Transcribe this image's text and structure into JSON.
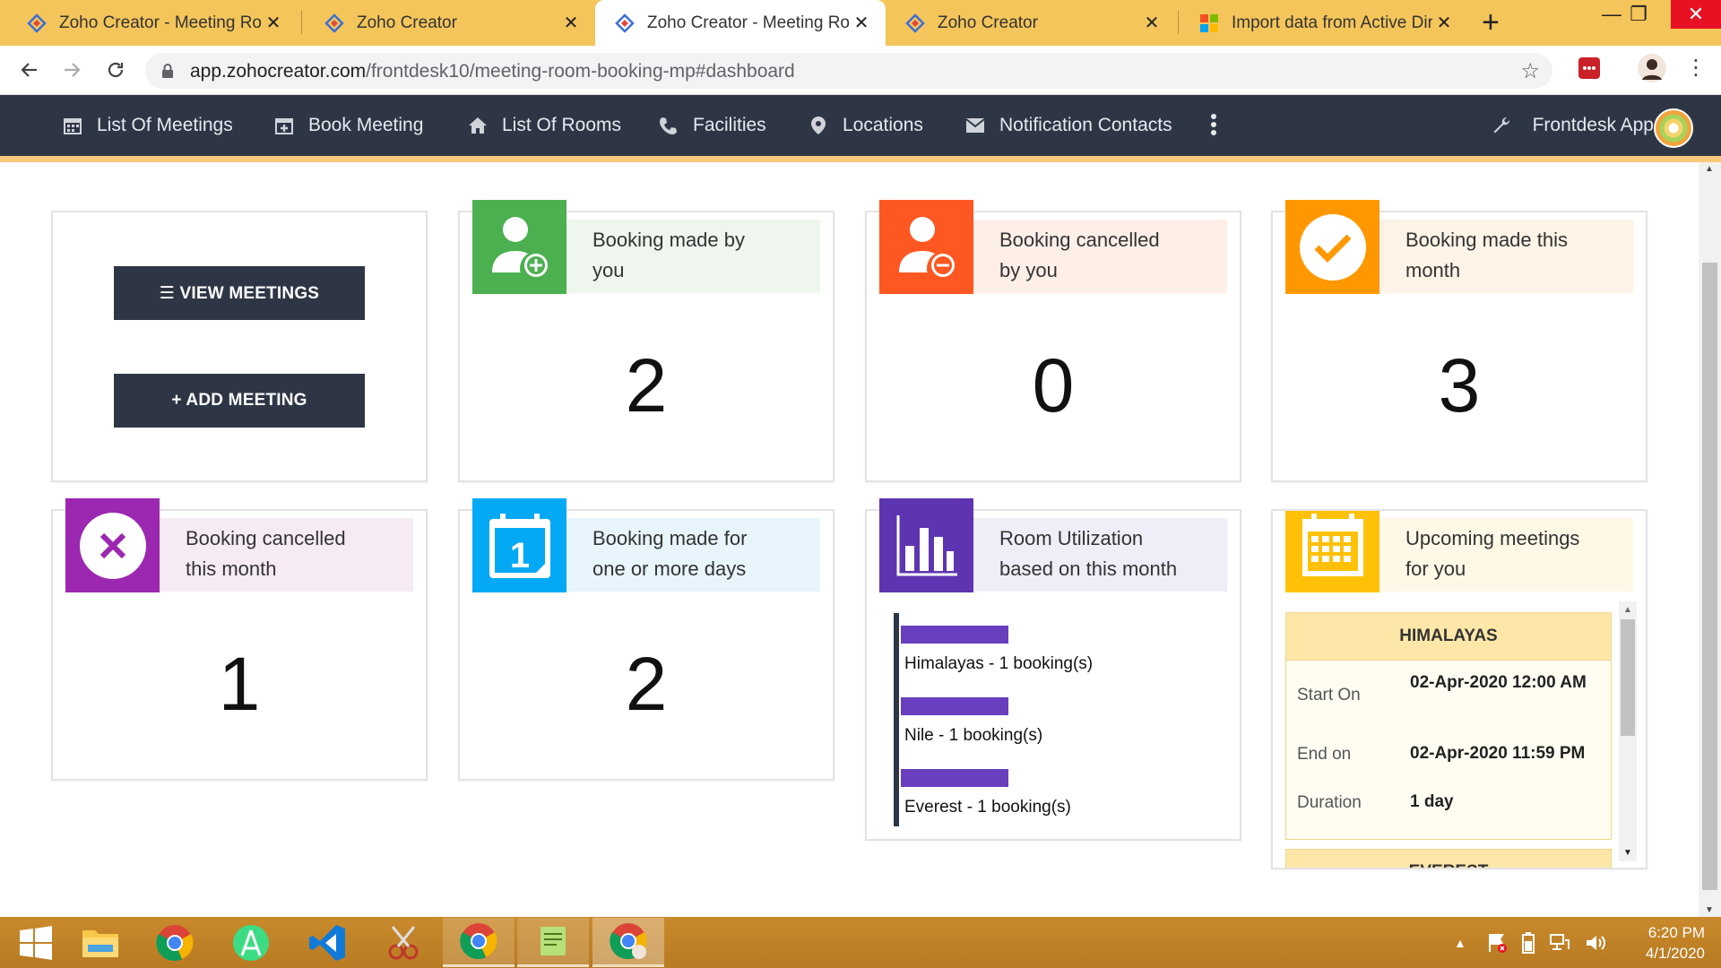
{
  "browser": {
    "tabs": [
      {
        "title": "Zoho Creator - Meeting Roo",
        "close": "✕"
      },
      {
        "title": "Zoho Creator",
        "close": "✕"
      },
      {
        "title": "Zoho Creator - Meeting Roo",
        "close": "✕"
      },
      {
        "title": "Zoho Creator",
        "close": "✕"
      },
      {
        "title": "Import data from Active Dire",
        "close": "✕"
      }
    ],
    "new_tab": "+",
    "window_controls": {
      "minimize": "—",
      "maximize": "❐",
      "close": "✕"
    },
    "url_host": "app.zohocreator.com",
    "url_path": "/frontdesk10/meeting-room-booking-mp#dashboard"
  },
  "nav": {
    "items": [
      {
        "label": "List Of Meetings",
        "icon": "calendar-icon"
      },
      {
        "label": "Book Meeting",
        "icon": "calendar-plus-icon"
      },
      {
        "label": "List Of Rooms",
        "icon": "home-icon"
      },
      {
        "label": "Facilities",
        "icon": "phone-icon"
      },
      {
        "label": "Locations",
        "icon": "map-pin-icon"
      },
      {
        "label": "Notification Contacts",
        "icon": "envelope-icon"
      }
    ],
    "app_name": "Frontdesk App"
  },
  "actions": {
    "view_meetings": "☰ VIEW MEETINGS",
    "add_meeting": "+ ADD MEETING"
  },
  "cards": [
    {
      "label_line1": "Booking made by",
      "label_line2": "you",
      "value": "2",
      "color": "#4caf50",
      "tint": "#eef6ee"
    },
    {
      "label_line1": "Booking cancelled",
      "label_line2": "by you",
      "value": "0",
      "color": "#ff5722",
      "tint": "#fdeee8"
    },
    {
      "label_line1": "Booking made this",
      "label_line2": "month",
      "value": "3",
      "color": "#ff9800",
      "tint": "#fdf3e6"
    },
    {
      "label_line1": "Booking cancelled",
      "label_line2": "this month",
      "value": "1",
      "color": "#9c27b0",
      "tint": "#f6ebf5"
    },
    {
      "label_line1": "Booking made for",
      "label_line2": "one or more days",
      "value": "2",
      "color": "#03a9f4",
      "tint": "#e8f5fc"
    },
    {
      "label_line1": "Room Utilization",
      "label_line2": "based on this month",
      "color": "#5e35b1",
      "tint": "#efedf7"
    },
    {
      "label_line1": "Upcoming meetings",
      "label_line2": "for you",
      "color": "#ffc107",
      "tint": "#fff8e6"
    }
  ],
  "utilization": {
    "rows": [
      {
        "label": "Himalayas - 1 booking(s)",
        "bookings": 1
      },
      {
        "label": "Nile - 1 booking(s)",
        "bookings": 1
      },
      {
        "label": "Everest - 1 booking(s)",
        "bookings": 1
      }
    ],
    "bar_color": "#6a3fbf"
  },
  "upcoming": {
    "room": "HIMALAYAS",
    "start_label": "Start On",
    "start_value": "02-Apr-2020 12:00 AM",
    "end_label": "End on",
    "end_value": "02-Apr-2020 11:59 PM",
    "duration_label": "Duration",
    "duration_value": "1 day",
    "next_room": "EVEREST"
  },
  "taskbar": {
    "apps": [
      "windows-start-icon",
      "file-explorer-icon",
      "chrome-icon",
      "android-studio-icon",
      "vscode-icon",
      "snipping-tool-icon",
      "chrome-icon",
      "notepad-icon",
      "chrome-profile-icon"
    ],
    "time": "6:20 PM",
    "date": "4/1/2020"
  }
}
